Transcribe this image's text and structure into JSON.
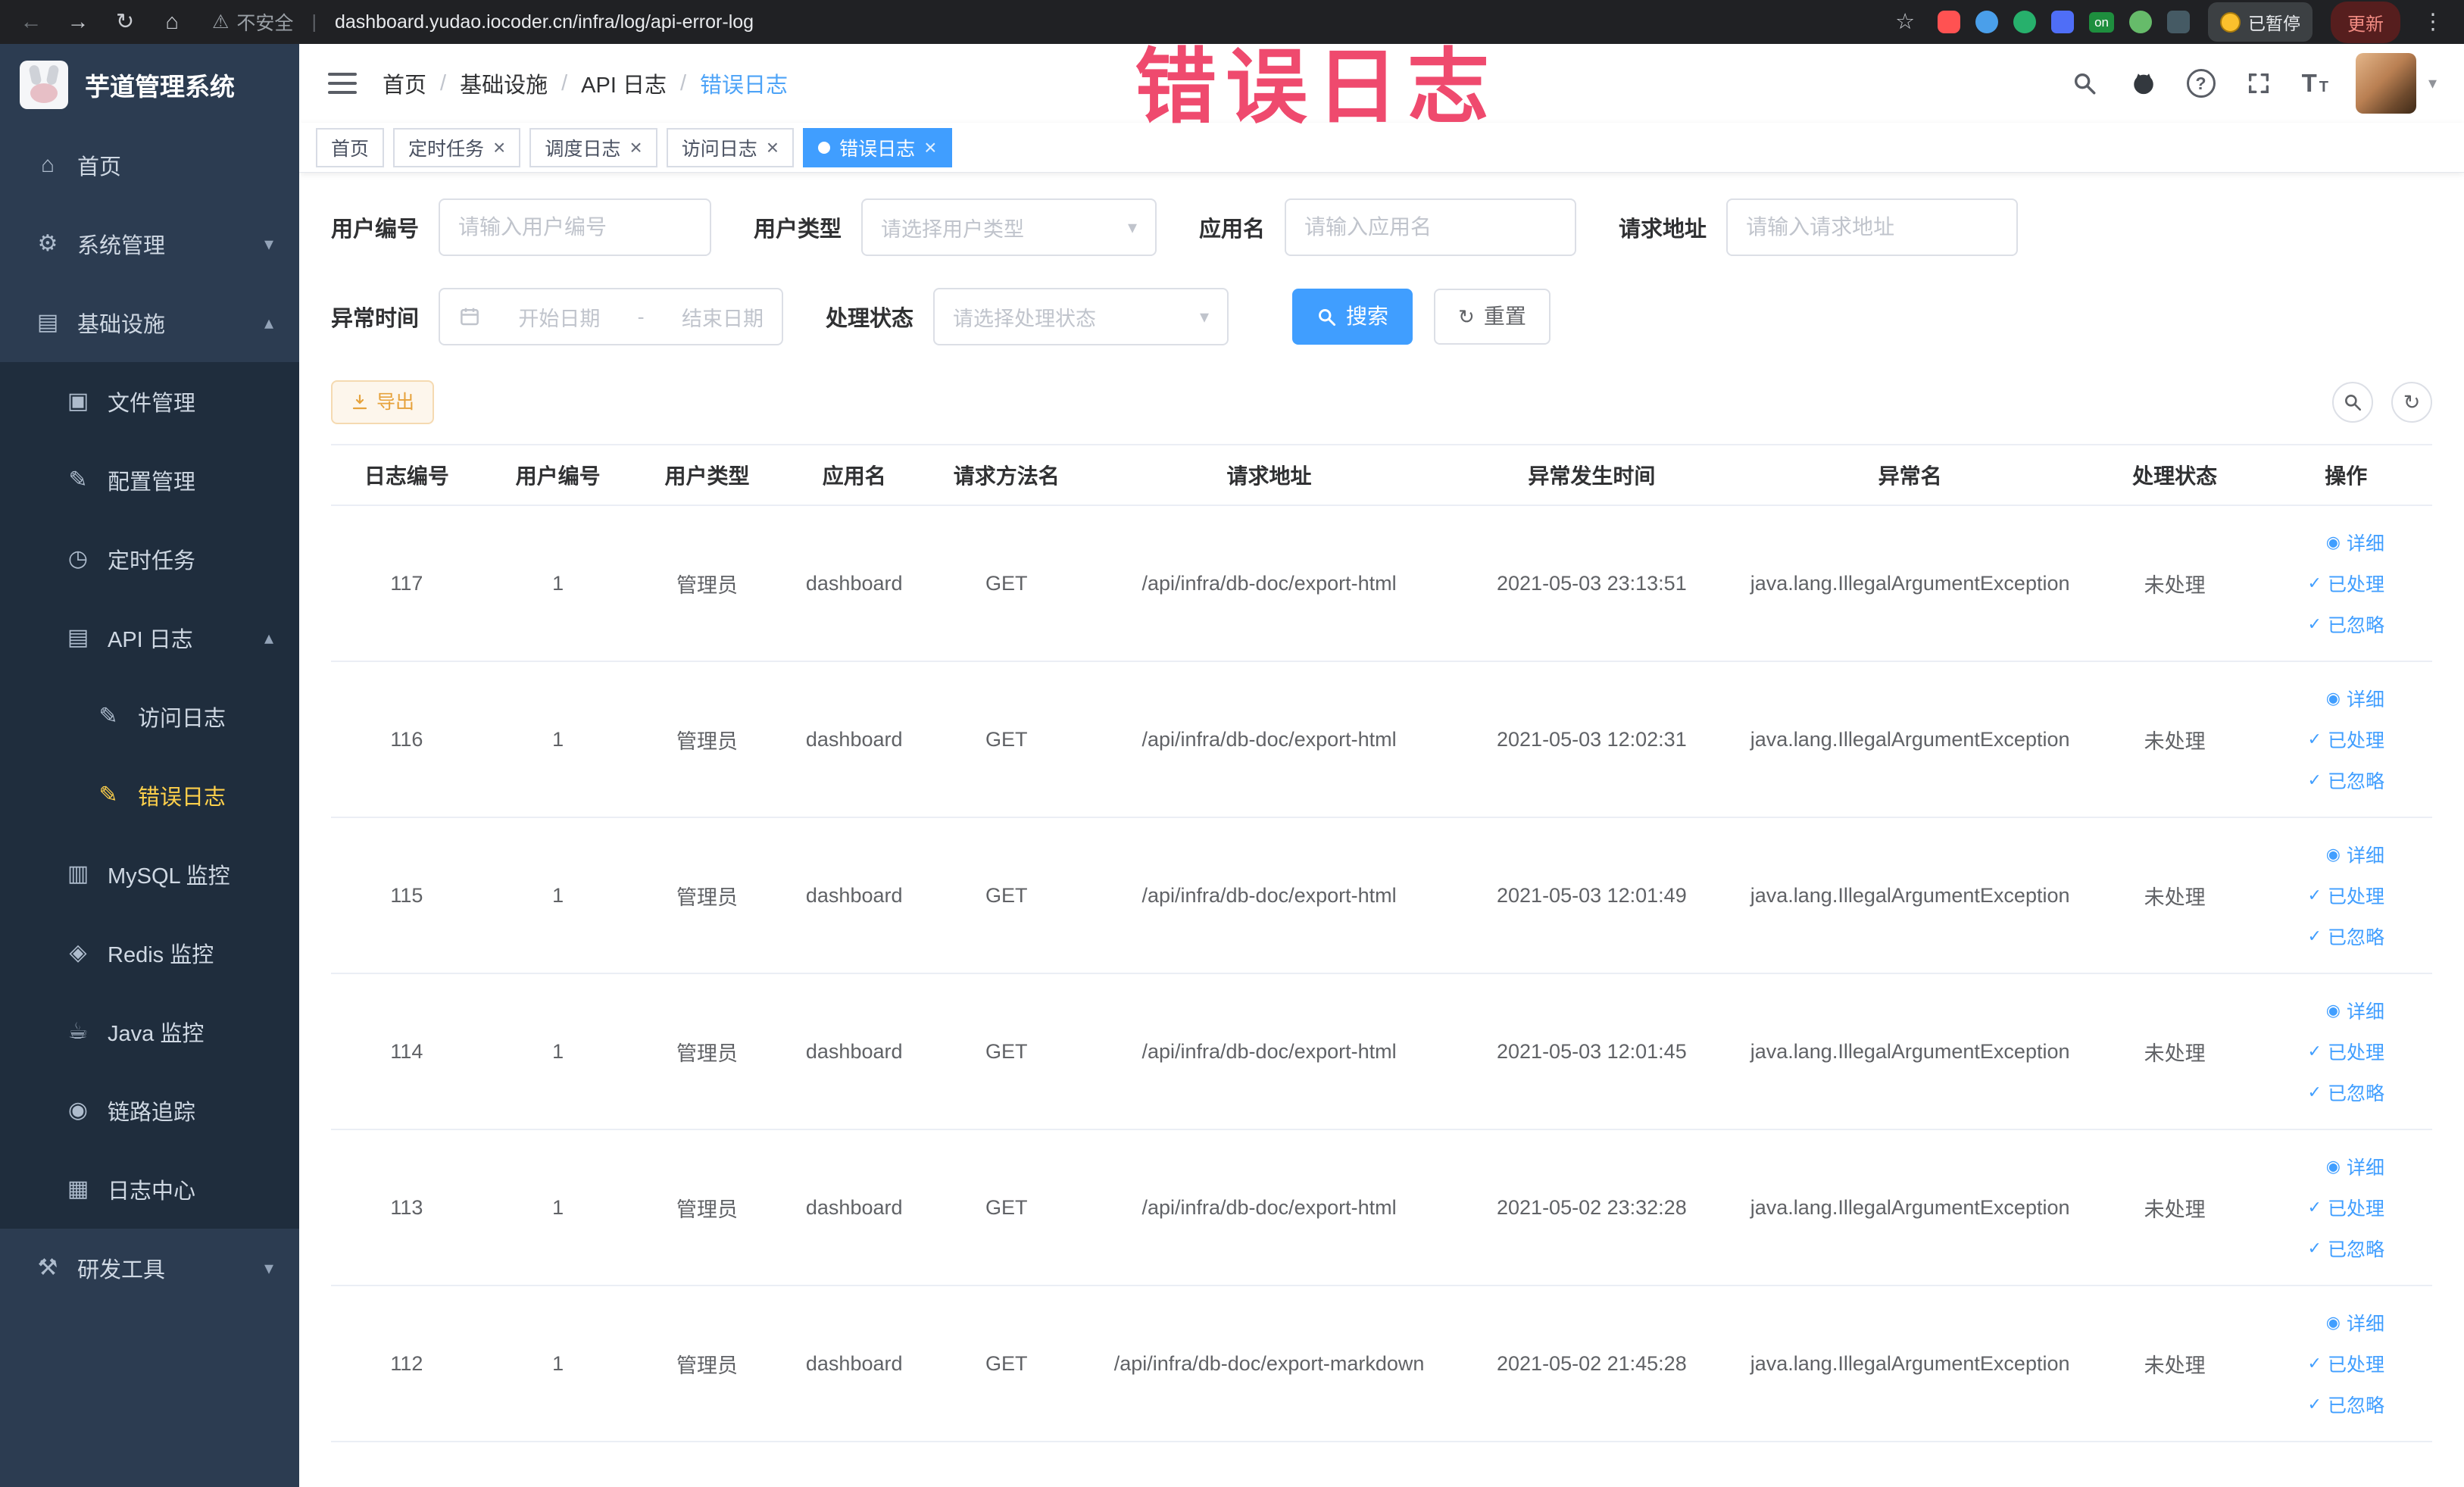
{
  "colors": {
    "accent": "#409eff",
    "menu_active": "#ffd04b",
    "warning": "#e6a23c",
    "annotation": "#ef4a6e",
    "sidebar_bg": "#2c3c51",
    "submenu_bg": "#1f2d3d"
  },
  "icons": {
    "back-icon": "←",
    "forward-icon": "→",
    "refresh-icon": "↻",
    "home-icon": "⌂",
    "warning-icon": "⚠",
    "star-icon": "☆",
    "kebab-icon": "⋮",
    "help-icon": "?",
    "chevron-down-icon": "▾",
    "chevron-up-icon": "▴",
    "font-size-icon": "T",
    "eye-icon": "◉",
    "check-icon": "✓",
    "gear-icon": "⚙",
    "infra-icon": "▤",
    "file-icon": "▣",
    "config-icon": "✎",
    "job-icon": "◷",
    "api-log-icon": "▤",
    "access-log-icon": "✎",
    "error-log-icon": "✎",
    "mysql-icon": "▥",
    "redis-icon": "◈",
    "java-icon": "☕",
    "trace-icon": "◉",
    "log-center-icon": "▦",
    "tools-icon": "⚒"
  },
  "browser": {
    "security_label": "不安全",
    "url_divider": "|",
    "url": "dashboard.yudao.iocoder.cn/infra/log/api-error-log",
    "extension_badge": "on",
    "paused_label": "已暂停",
    "update_label": "更新"
  },
  "annotation": {
    "text": "错误日志"
  },
  "sidebar": {
    "logo_title": "芋道管理系统",
    "menu": [
      {
        "name": "home",
        "label": "首页",
        "icon": "home-icon",
        "level": 1
      },
      {
        "name": "system",
        "label": "系统管理",
        "icon": "gear-icon",
        "level": 1,
        "chevron": "down"
      },
      {
        "name": "infra",
        "label": "基础设施",
        "icon": "infra-icon",
        "level": 1,
        "chevron": "up"
      },
      {
        "name": "file-manage",
        "label": "文件管理",
        "icon": "file-icon",
        "level": 2
      },
      {
        "name": "config-manage",
        "label": "配置管理",
        "icon": "config-icon",
        "level": 2
      },
      {
        "name": "cron-job",
        "label": "定时任务",
        "icon": "job-icon",
        "level": 2
      },
      {
        "name": "api-log",
        "label": "API 日志",
        "icon": "api-log-icon",
        "level": 2,
        "chevron": "up"
      },
      {
        "name": "access-log",
        "label": "访问日志",
        "icon": "access-log-icon",
        "level": 3
      },
      {
        "name": "error-log",
        "label": "错误日志",
        "icon": "error-log-icon",
        "level": 3,
        "active": true
      },
      {
        "name": "mysql-monitor",
        "label": "MySQL 监控",
        "icon": "mysql-icon",
        "level": 2
      },
      {
        "name": "redis-monitor",
        "label": "Redis 监控",
        "icon": "redis-icon",
        "level": 2
      },
      {
        "name": "java-monitor",
        "label": "Java 监控",
        "icon": "java-icon",
        "level": 2
      },
      {
        "name": "trace",
        "label": "链路追踪",
        "icon": "trace-icon",
        "level": 2
      },
      {
        "name": "log-center",
        "label": "日志中心",
        "icon": "log-center-icon",
        "level": 2
      },
      {
        "name": "dev-tools",
        "label": "研发工具",
        "icon": "tools-icon",
        "level": 1,
        "chevron": "down"
      }
    ]
  },
  "navbar": {
    "breadcrumb": [
      "首页",
      "基础设施",
      "API 日志",
      "错误日志"
    ],
    "separator": "/"
  },
  "tags": [
    {
      "name": "home",
      "label": "首页",
      "closable": false,
      "active": false
    },
    {
      "name": "cron-job",
      "label": "定时任务",
      "closable": true,
      "active": false
    },
    {
      "name": "job-log",
      "label": "调度日志",
      "closable": true,
      "active": false
    },
    {
      "name": "access-log",
      "label": "访问日志",
      "closable": true,
      "active": false
    },
    {
      "name": "error-log",
      "label": "错误日志",
      "closable": true,
      "active": true
    }
  ],
  "filters": {
    "user_id": {
      "label": "用户编号",
      "placeholder": "请输入用户编号"
    },
    "user_type": {
      "label": "用户类型",
      "placeholder": "请选择用户类型"
    },
    "app_name": {
      "label": "应用名",
      "placeholder": "请输入应用名"
    },
    "request_url": {
      "label": "请求地址",
      "placeholder": "请输入请求地址"
    },
    "exception_time": {
      "label": "异常时间",
      "start_placeholder": "开始日期",
      "separator": "-",
      "end_placeholder": "结束日期"
    },
    "process_status": {
      "label": "处理状态",
      "placeholder": "请选择处理状态"
    },
    "search_label": "搜索",
    "reset_label": "重置"
  },
  "toolbar": {
    "export_label": "导出"
  },
  "table": {
    "columns": [
      "日志编号",
      "用户编号",
      "用户类型",
      "应用名",
      "请求方法名",
      "请求地址",
      "异常发生时间",
      "异常名",
      "处理状态",
      "操作"
    ],
    "row_keys": [
      "id",
      "user_id",
      "user_type",
      "app_name",
      "method",
      "url",
      "time",
      "exception",
      "status"
    ],
    "actions": [
      {
        "name": "detail",
        "label": "详细",
        "icon": "eye-icon"
      },
      {
        "name": "mark-processed",
        "label": "已处理",
        "icon": "check-icon"
      },
      {
        "name": "mark-ignored",
        "label": "已忽略",
        "icon": "check-icon"
      }
    ],
    "rows": [
      {
        "id": "117",
        "user_id": "1",
        "user_type": "管理员",
        "app_name": "dashboard",
        "method": "GET",
        "url": "/api/infra/db-doc/export-html",
        "time": "2021-05-03 23:13:51",
        "exception": "java.lang.IllegalArgumentException",
        "status": "未处理"
      },
      {
        "id": "116",
        "user_id": "1",
        "user_type": "管理员",
        "app_name": "dashboard",
        "method": "GET",
        "url": "/api/infra/db-doc/export-html",
        "time": "2021-05-03 12:02:31",
        "exception": "java.lang.IllegalArgumentException",
        "status": "未处理"
      },
      {
        "id": "115",
        "user_id": "1",
        "user_type": "管理员",
        "app_name": "dashboard",
        "method": "GET",
        "url": "/api/infra/db-doc/export-html",
        "time": "2021-05-03 12:01:49",
        "exception": "java.lang.IllegalArgumentException",
        "status": "未处理"
      },
      {
        "id": "114",
        "user_id": "1",
        "user_type": "管理员",
        "app_name": "dashboard",
        "method": "GET",
        "url": "/api/infra/db-doc/export-html",
        "time": "2021-05-03 12:01:45",
        "exception": "java.lang.IllegalArgumentException",
        "status": "未处理"
      },
      {
        "id": "113",
        "user_id": "1",
        "user_type": "管理员",
        "app_name": "dashboard",
        "method": "GET",
        "url": "/api/infra/db-doc/export-html",
        "time": "2021-05-02 23:32:28",
        "exception": "java.lang.IllegalArgumentException",
        "status": "未处理"
      },
      {
        "id": "112",
        "user_id": "1",
        "user_type": "管理员",
        "app_name": "dashboard",
        "method": "GET",
        "url": "/api/infra/db-doc/export-markdown",
        "time": "2021-05-02 21:45:28",
        "exception": "java.lang.IllegalArgumentException",
        "status": "未处理"
      }
    ]
  }
}
